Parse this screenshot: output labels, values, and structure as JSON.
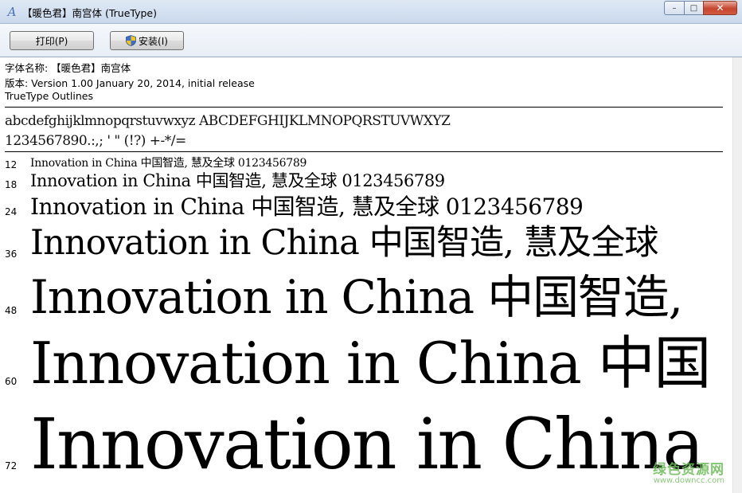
{
  "window": {
    "title": "【暖色君】南宫体 (TrueType)",
    "controls": {
      "minimize": "–",
      "maximize": "□",
      "close": "✕"
    }
  },
  "toolbar": {
    "print_label": "打印(P)",
    "install_label": "安装(I)"
  },
  "font_info": {
    "name_line": "字体名称: 【暖色君】南宫体",
    "version_line": "版本: Version 1.00 January 20, 2014, initial release",
    "outline_line": "TrueType Outlines"
  },
  "charset": {
    "line1": "abcdefghijklmnopqrstuvwxyz ABCDEFGHIJKLMNOPQRSTUVWXYZ",
    "line2": "1234567890.:,; ' \" (!?) +-*/="
  },
  "samples": [
    {
      "size": "12",
      "text": "Innovation in China 中国智造, 慧及全球 0123456789"
    },
    {
      "size": "18",
      "text": "Innovation in China 中国智造, 慧及全球 0123456789"
    },
    {
      "size": "24",
      "text": "Innovation in China 中国智造, 慧及全球 0123456789"
    },
    {
      "size": "36",
      "text": "Innovation in China 中国智造, 慧及全球"
    },
    {
      "size": "48",
      "text": "Innovation in China 中国智造,"
    },
    {
      "size": "60",
      "text": "Innovation in China 中国"
    },
    {
      "size": "72",
      "text": "Innovation in China"
    }
  ],
  "watermark": {
    "main": "绿色资源网",
    "sub": "www.downcc.com"
  },
  "colors": {
    "titlebar": "#c9d9ec",
    "close_button": "#c6452e",
    "watermark": "#6dbb58"
  },
  "icons": {
    "app": "font-viewer-icon",
    "install": "uac-shield-icon"
  }
}
